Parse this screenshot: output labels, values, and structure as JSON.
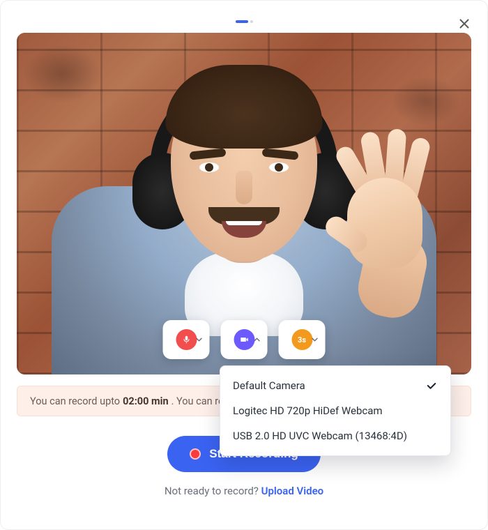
{
  "pager": {
    "total": 2,
    "active": 0
  },
  "controls": {
    "mic": {
      "icon": "mic-icon",
      "open": false
    },
    "cam": {
      "icon": "camera-icon",
      "open": true
    },
    "timer": {
      "icon": "timer-icon",
      "label": "3s",
      "open": false
    }
  },
  "camera_menu": {
    "options": [
      {
        "label": "Default Camera",
        "selected": true
      },
      {
        "label": "Logitec HD 720p HiDef Webcam",
        "selected": false
      },
      {
        "label": "USB 2.0 HD UVC Webcam (13468:4D)",
        "selected": false
      }
    ]
  },
  "info": {
    "prefix": "You can record upto ",
    "limit": "02:00 min",
    "suffix": ". You can re-record or trim later."
  },
  "cta": {
    "label": "Start Recording"
  },
  "footer": {
    "prompt": "Not ready to record? ",
    "link": "Upload Video"
  }
}
